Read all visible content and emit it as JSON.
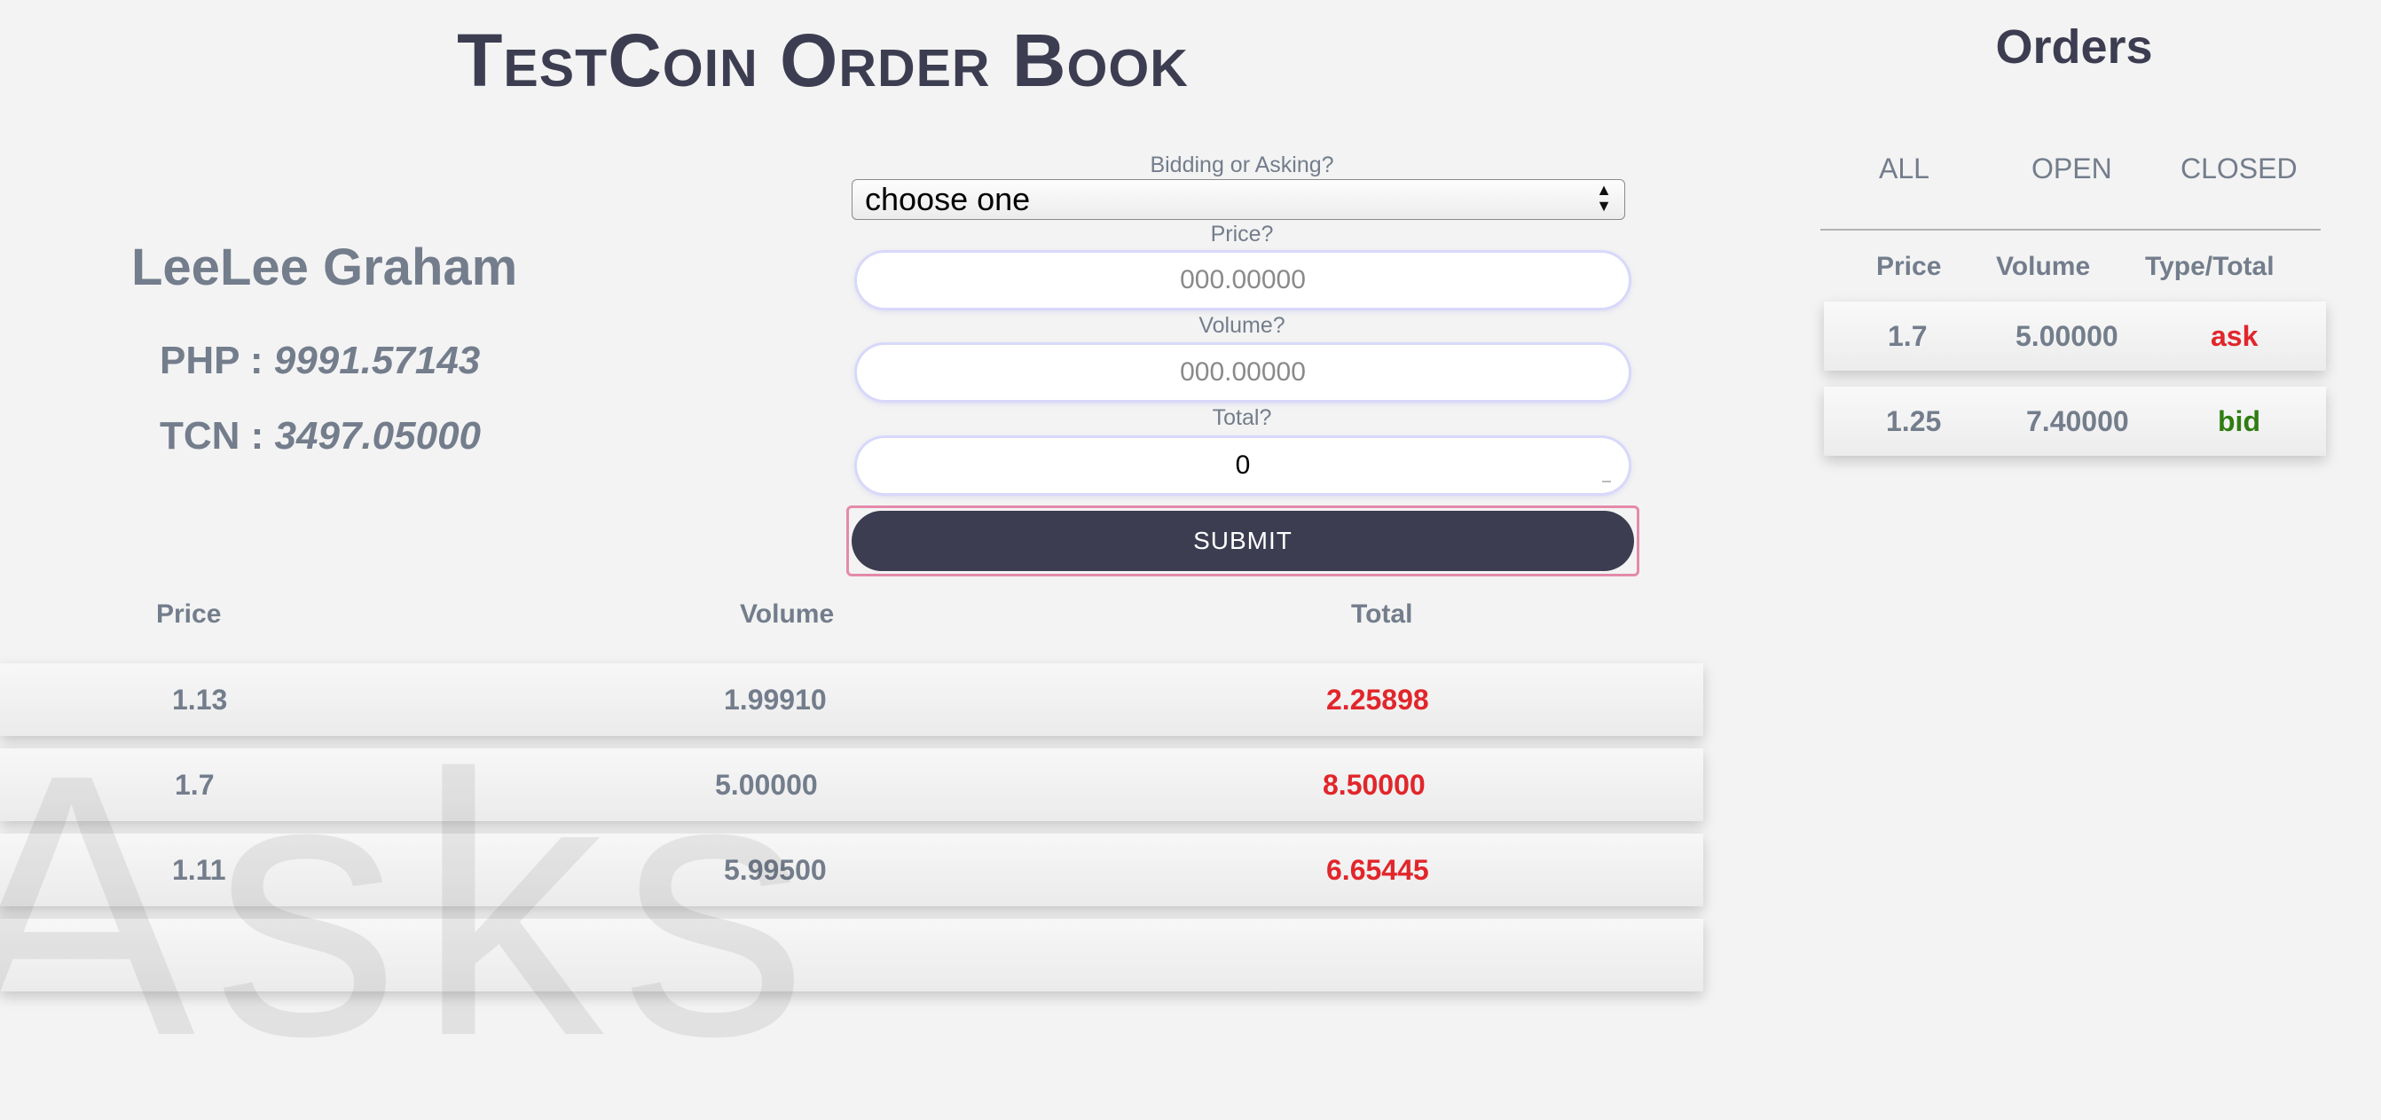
{
  "header": {
    "title": "TestCoin Order Book"
  },
  "user": {
    "name": "LeeLee Graham",
    "balances": [
      {
        "currency": "PHP",
        "separator": " : ",
        "amount": "9991.57143"
      },
      {
        "currency": "TCN",
        "separator": " : ",
        "amount": "3497.05000"
      }
    ]
  },
  "form": {
    "bid_ask_label": "Bidding or Asking?",
    "bid_ask_value": "choose one",
    "price_label": "Price?",
    "price_placeholder": "000.00000",
    "volume_label": "Volume?",
    "volume_placeholder": "000.00000",
    "total_label": "Total?",
    "total_value": "0",
    "submit_label": "SUBMIT"
  },
  "order_table": {
    "headers": {
      "price": "Price",
      "volume": "Volume",
      "total": "Total"
    },
    "rows": [
      {
        "price": "1.13",
        "volume": "1.99910",
        "total": "2.25898"
      },
      {
        "price": "1.7",
        "volume": "5.00000",
        "total": "8.50000"
      },
      {
        "price": "1.11",
        "volume": "5.99500",
        "total": "6.65445"
      }
    ],
    "total_color": "#e1262b"
  },
  "orders_panel": {
    "title": "Orders",
    "tabs": [
      "ALL",
      "OPEN",
      "CLOSED"
    ],
    "headers": {
      "price": "Price",
      "volume": "Volume",
      "type": "Type/Total"
    },
    "rows": [
      {
        "price": "1.7",
        "volume": "5.00000",
        "type": "ask"
      },
      {
        "price": "1.25",
        "volume": "7.40000",
        "type": "bid"
      }
    ],
    "colors": {
      "ask": "#e1262b",
      "bid": "#2f7d12"
    }
  },
  "colors": {
    "primary": "#3d3d52",
    "text_muted": "#737d8c",
    "background": "#f3f3f3"
  }
}
